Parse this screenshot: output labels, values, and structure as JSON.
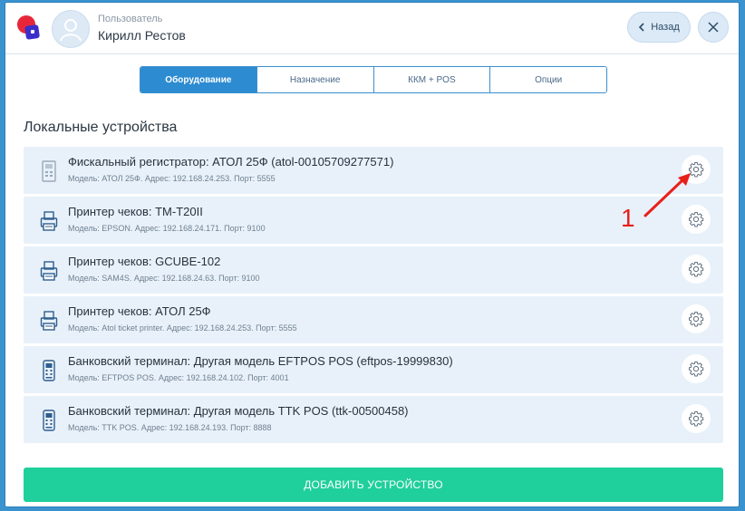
{
  "header": {
    "user_role": "Пользователь",
    "user_name": "Кирилл Рестов",
    "back_label": "Назад"
  },
  "tabs": [
    {
      "label": "Оборудование",
      "active": true
    },
    {
      "label": "Назначение",
      "active": false
    },
    {
      "label": "ККМ + POS",
      "active": false
    },
    {
      "label": "Опции",
      "active": false
    }
  ],
  "section_title": "Локальные устройства",
  "devices": [
    {
      "title": "Фискальный регистратор: АТОЛ 25Ф (atol-00105709277571)",
      "subtitle": "Модель: АТОЛ 25Ф. Адрес: 192.168.24.253. Порт: 5555",
      "icon": "fiscal-register-icon"
    },
    {
      "title": "Принтер чеков: TM-T20II",
      "subtitle": "Модель: EPSON. Адрес: 192.168.24.171. Порт: 9100",
      "icon": "receipt-printer-icon"
    },
    {
      "title": "Принтер чеков: GCUBE-102",
      "subtitle": "Модель: SAM4S. Адрес: 192.168.24.63. Порт: 9100",
      "icon": "receipt-printer-icon"
    },
    {
      "title": "Принтер чеков: АТОЛ 25Ф",
      "subtitle": "Модель: Atol ticket printer. Адрес: 192.168.24.253. Порт: 5555",
      "icon": "receipt-printer-icon"
    },
    {
      "title": "Банковский терминал: Другая модель EFTPOS POS (eftpos-19999830)",
      "subtitle": "Модель: EFTPOS POS. Адрес: 192.168.24.102. Порт: 4001",
      "icon": "bank-terminal-icon"
    },
    {
      "title": "Банковский терминал: Другая модель TTK POS (ttk-00500458)",
      "subtitle": "Модель: TTK POS. Адрес: 192.168.24.193. Порт: 8888",
      "icon": "bank-terminal-icon"
    }
  ],
  "add_button_label": "ДОБАВИТЬ УСТРОЙСТВО",
  "annotation": {
    "label": "1",
    "color": "#e8201c"
  },
  "colors": {
    "accent": "#2d8bd1",
    "add_button": "#1fcf9c",
    "row_bg": "#e8f1fa",
    "frame": "#3a93cf"
  }
}
